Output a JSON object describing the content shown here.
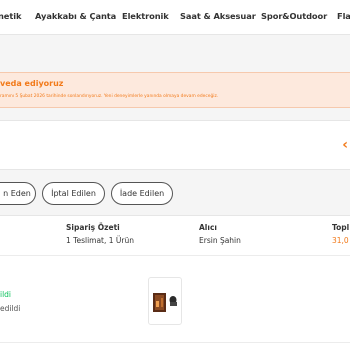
{
  "nav": {
    "items": [
      "netik",
      "Ayakkabı & Çanta",
      "Elektronik",
      "Saat & Aksesuar",
      "Spor&Outdoor",
      "Fla"
    ]
  },
  "banner": {
    "title": "veda ediyoruz",
    "text": "ramını 5 Şubat 2026 tarihinde sonlandırıyoruz. Yeni deneyimlerle yanında olmaya devam edeceğiz."
  },
  "tabs": [
    "n Eden",
    "İptal Edilen",
    "İade Edilen"
  ],
  "order": {
    "summary_header": "Sipariş Özeti",
    "summary_value": "1 Teslimat, 1 Ürün",
    "recipient_header": "Alıcı",
    "recipient_value": "Ersin Şahin",
    "total_header": "Topl",
    "total_value": "31,0",
    "status_line1": "ildi",
    "status_line2": "edildi"
  },
  "icons": {
    "card_action": "chevron-left-icon",
    "product": "product-thumbnail"
  },
  "colors": {
    "accent": "#f27a1a",
    "delivered": "#0bc15c",
    "banner_bg": "#fde9dd"
  }
}
